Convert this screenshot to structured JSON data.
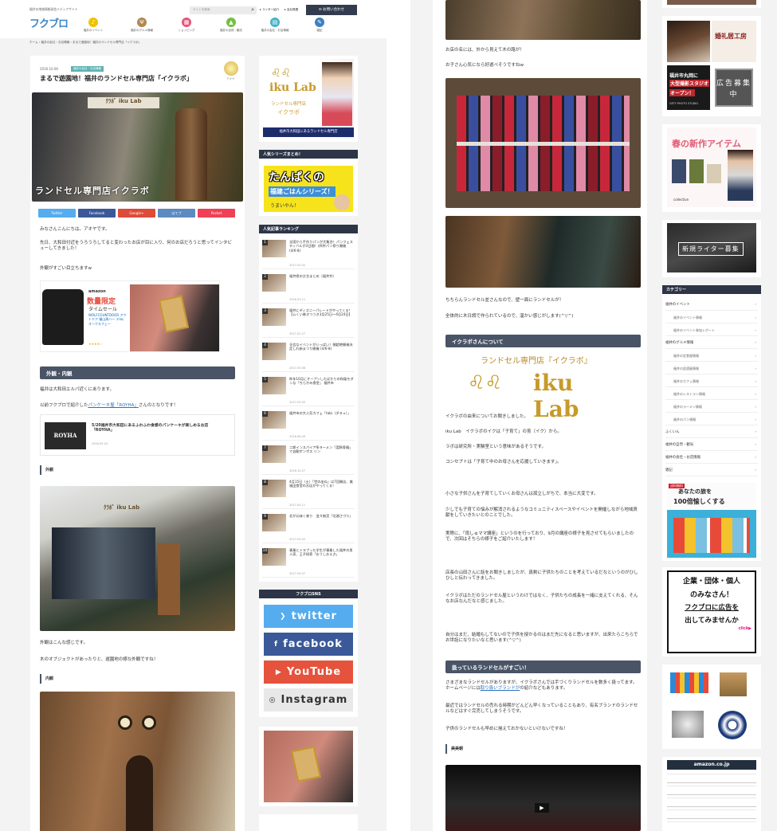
{
  "left": {
    "header": {
      "tagline": "福井の地域情報発信メディアサイト",
      "logo": "フクブロ",
      "search_placeholder": "サイト内検索",
      "writer_link": "ライター紹介",
      "company_link": "会社概要",
      "contact_button": "お問い合わせ",
      "nav": [
        {
          "label": "福井のイベント",
          "icon": "♪",
          "color": "#f0c200"
        },
        {
          "label": "福井のグルメ情報",
          "icon": "Ψ",
          "color": "#b08850"
        },
        {
          "label": "ショッピング",
          "icon": "▦",
          "color": "#e8557a"
        },
        {
          "label": "福井の自然・観光",
          "icon": "▲",
          "color": "#74c043"
        },
        {
          "label": "福井の会社・お店情報",
          "icon": "▤",
          "color": "#45b3c4"
        },
        {
          "label": "雑記",
          "icon": "✎",
          "color": "#3d7fc1"
        }
      ]
    },
    "breadcrumb": "ホーム › 福井の会社・お店情報 › まるで遊園地！福井のランドセル専門店「イクラボ」",
    "article": {
      "date": "2016.10.06",
      "category": "福井の会社・お店情報",
      "title": "まるで遊園地！福井のランドセル専門店「イクラボ」",
      "author": "アオヤ",
      "hero_caption": "ランドセル専門店イクラボ",
      "share": [
        {
          "label": "Twitter",
          "color": "#55acee"
        },
        {
          "label": "Facebook",
          "color": "#3b5998"
        },
        {
          "label": "Google+",
          "color": "#dd4b39"
        },
        {
          "label": "はてブ",
          "color": "#5d8ac1"
        },
        {
          "label": "Pocket",
          "color": "#ef4056"
        }
      ],
      "p1": "みなさんこんにちは。アオヤです。",
      "p2": "先日、大和田付近をうろうろしてると変わったお店が目に入り、何のお店だろうと思ってインタビューしてきました！",
      "p3": "外観がすごい目立ちますw",
      "ad_title": "数量限定",
      "ad_sub": "タイムセール",
      "ad_text": "WOLFCOUNTDOOR アウトドア 福山周ハー デoo, オークスフェー",
      "ad_brand": "amazon",
      "heading1": "外観・内観",
      "p4": "福井は大和田エルパ近くにあります。",
      "p5a": "以前フクブロで紹介した",
      "p5link": "パンケーキ屋「ROYHA」",
      "p5b": "さんのとなりです！",
      "related_title": "5/20福井市大和田にあるふわふわ食感のパンケーキが楽しめるお店「ROYHA」",
      "related_date": "2016.05.20",
      "related_logo": "ROYHA",
      "sub1": "外観",
      "p6": "外観はこんな感じです。",
      "p7": "木のオブジェクトがあったりと、遊園地の様な外観ですね！",
      "sub2": "内観"
    },
    "sidebar": {
      "ad_logo": "iku Lab",
      "ad_sub1": "ランドセル専門店",
      "ad_sub2": "イクラボ",
      "ad_band": "福井市大和田にあるランドセル専門店",
      "series_head": "人気シリーズまとめ！",
      "series_banner": "たんぱくの",
      "series_banner2": "福建ごはんシリーズ！",
      "series_banner3": "うまいやん！",
      "ranking_head": "人気記事ランキング",
      "ranking": [
        {
          "title": "全国から手作りパンが大集合！パンフェスティバルが3日間！(杯杯パン祭り開催 (4/6-8)",
          "date": "2017.03.02"
        },
        {
          "title": "福井県の方言まとめ（福井弁）",
          "date": "2016.03.11"
        },
        {
          "title": "福井にディズニーパレードがやってくる！【ムくい巻きつうき3月25日～4月24日】",
          "date": "2017.02.27"
        },
        {
          "title": "全会なイベントがいっぱい！開超絶開催決定しれ新まつり開催 (4/6-8)",
          "date": "2017.03.06"
        },
        {
          "title": "昨年10月にオープンしたばかりの和風モダンな「ちらかみ食堂」 福井市",
          "date": "2017.03.03"
        },
        {
          "title": "福井市の大人気カフェ「tabi（ダラュ）」",
          "date": "2016.06.09"
        },
        {
          "title": "二郎インスパイア系ラーメン「度豚骨麺」で自動ポンポス リン",
          "date": "2016.10.27"
        },
        {
          "title": "4月15日（土）「世の出ね」は7回開店、美福田食堂のお店がやってくる！",
          "date": "2017.04.11"
        },
        {
          "title": "北が元味く巻り　並々無宮「北湘さづり」",
          "date": "2017.03.03"
        },
        {
          "title": "事業とトラブった学生が事業した福井の男人家、王子探索「おうしおえき」",
          "date": "2017.04.07"
        }
      ],
      "sns_head": "フクブロSNS",
      "sns": [
        {
          "label": "twitter",
          "icon": "❯",
          "color": "#55acee"
        },
        {
          "label": "facebook",
          "icon": "f",
          "color": "#3b5998"
        },
        {
          "label": "YouTube",
          "icon": "▶",
          "color": "#e5533d"
        },
        {
          "label": "Instagram",
          "icon": "◎",
          "color": "#e8e8e8",
          "text": "#333"
        }
      ]
    }
  },
  "right": {
    "p1": "お店の名には、外から見えて木の路が！",
    "p2": "お子さん心気になら好遊べそうですねw",
    "p3": "ちちらんランドセル並さんなので、壁一面にランドセルが！",
    "p4": "全体的に木日調で作られているので、温かい感じがします(^▽^)",
    "heading1": "イクラボさんについて",
    "logo_sub": "ランドセル専門店『イクラボ』",
    "logo_main": "iku Lab",
    "p5": "イクラボの由来についてお聞きしました。",
    "p6": "iku Lab　イクラボのイクは「子育て」の育（イク）から。",
    "p7": "ラボは研究所・実験室という意味があるそうです。",
    "p8": "コンセプトは「子育て中のお母さんを応援していきます」。",
    "p9": "小さな子供さんを子育てしていくお母さんは孤立しがちで、本当に大変です。",
    "p10": "少しでも子育ての悩みが解消されるようなコミュニティスペースやイベントを開催しながら地域貢献をしていきたいとのことでした。",
    "p11": "実際に、「雨しゅママ講座」というのを行っており、9月の講座の様子を見させてもらいましたので、次回はそちらの様子をご紹介いたします！",
    "p12": "店長の山田さんに話をお聞きしましたが、真剣に子供たちのことを考えているだなというのがひしひしと伝わってきました。",
    "p13": "イクラボはただのランドセル屋というわけではなく、子供たちの成長を一緒に支えてくれる、そんなお店なんだなと感じました。",
    "p14": "自分はまだ、結婚もしてないので子供を授かるのはまだ先になると思いますが、出来たらこちらでお世話になりたいなと思います(^▽^)",
    "heading2": "扱っているランドセルがすごい！",
    "p15": "さまざまなランドセルがありますが、イクラボさんでは手づくりランドセルを数多く扱ってます。ホームページには",
    "p15link": "取り扱いブランドが",
    "p15b": "の紹介などもあります。",
    "p16": "最近ではランドセルの売れる時期がどんどん早くなっていることもあり、有名ブランドのランドセルなどはすぐ完売してしまうそうです。",
    "p17": "子供のランドセルも早めに揃えておかないといけないですね！",
    "sub1": "美美朝",
    "sidebar": {
      "ad1_title": "婚礼居工房",
      "ad1_sub": "福井市丸岡に",
      "ad1_sub2": "大型撮影スタジオ",
      "ad1_sub3": "オープン！",
      "ad1_side": "広告募集中",
      "ad1_studio": "GETY PHOTO STUDIO",
      "ad2_title": "春の新作アイテム",
      "ad2_shop": "collection",
      "ad3_text": "新規ライター募集",
      "cat_head": "カテゴリー",
      "categories": [
        {
          "label": "福井のイベント",
          "sub": false
        },
        {
          "label": "福井のイベント情報",
          "sub": true
        },
        {
          "label": "福井のイベント参加レポート",
          "sub": true
        },
        {
          "label": "福井のグルメ情報",
          "sub": false
        },
        {
          "label": "福井の定食屋情報",
          "sub": true
        },
        {
          "label": "福井の居酒屋情報",
          "sub": true
        },
        {
          "label": "福井のカフェ情報",
          "sub": true
        },
        {
          "label": "福井のレストラン情報",
          "sub": true
        },
        {
          "label": "福井のラーメン情報",
          "sub": true
        },
        {
          "label": "福井のパン情報",
          "sub": true
        },
        {
          "label": "ふくいん",
          "sub": false
        },
        {
          "label": "福井の自然・観光",
          "sub": false
        },
        {
          "label": "福井の会社・お店情報",
          "sub": false
        },
        {
          "label": "雑記",
          "sub": false
        }
      ],
      "travel_ad": "あなたの旅を",
      "travel_ad2": "100倍愉しくする",
      "ad_board1": "企業・団体・個人",
      "ad_board2": "のみなさん！",
      "ad_board3": "フクブロに広告を",
      "ad_board4": "出してみませんか",
      "ad_board5": "click▶",
      "amazon": "amazon.co.jp"
    }
  }
}
